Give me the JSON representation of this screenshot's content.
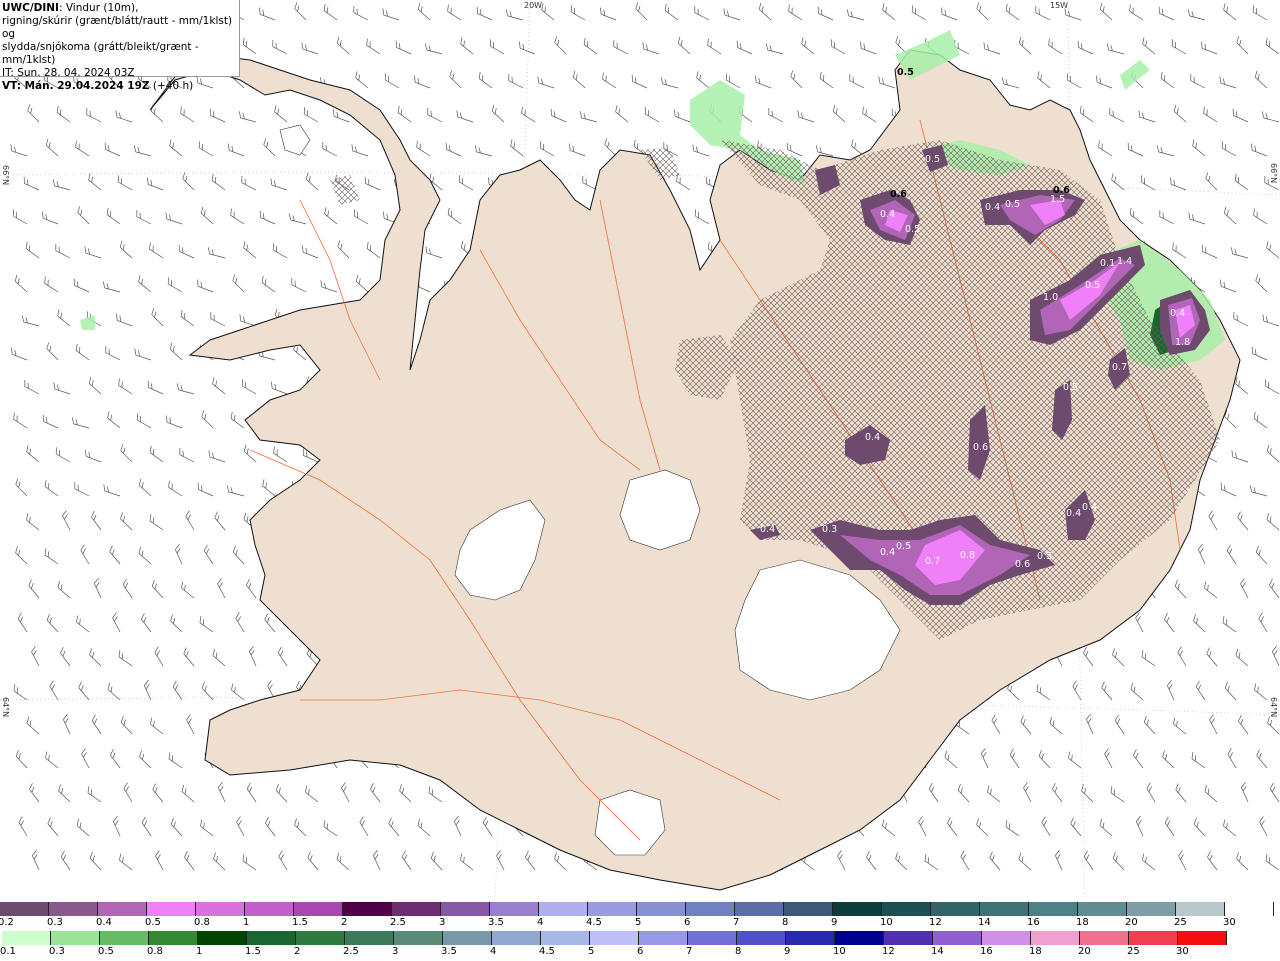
{
  "header": {
    "model": "UWC/DINI",
    "line1_rest": ": Vindur (10m),",
    "line2": "rigning/skúrir (grænt/blátt/rautt - mm/1klst) og",
    "line3": "slydda/snjókoma (grátt/bleikt/grænt - mm/1klst)",
    "it": "IT: Sun. 28. 04. 2024 03Z",
    "vt_bold": "VT: Mán. 29.04.2024 19Z",
    "vt_rest": " (+40 h)"
  },
  "grid_labels": {
    "lon20": "20W",
    "lon15": "15W",
    "lat66_left": "66°N",
    "lat66_right": "66°N",
    "lat64_left": "64°N",
    "lat64_right": "64°N"
  },
  "map_labels": [
    {
      "text": "0.5",
      "color": "#000000"
    },
    {
      "text": "0.5",
      "color": "#ffffff"
    },
    {
      "text": "0.6",
      "color": "#000000"
    },
    {
      "text": "0.6",
      "color": "#000000"
    },
    {
      "text": "0.4",
      "color": "#ffffff"
    },
    {
      "text": "0.5",
      "color": "#ffffff"
    },
    {
      "text": "1.5",
      "color": "#ffffff"
    },
    {
      "text": "0.4",
      "color": "#ffffff"
    },
    {
      "text": "0.5",
      "color": "#ffffff"
    },
    {
      "text": "0.1",
      "color": "#ffffff"
    },
    {
      "text": "1.4",
      "color": "#ffffff"
    },
    {
      "text": "0.5",
      "color": "#ffffff"
    },
    {
      "text": "1.0",
      "color": "#ffffff"
    },
    {
      "text": "0.4",
      "color": "#ffffff"
    },
    {
      "text": "1.8",
      "color": "#ffffff"
    },
    {
      "text": "0.7",
      "color": "#ffffff"
    },
    {
      "text": "0.5",
      "color": "#ffffff"
    },
    {
      "text": "0.4",
      "color": "#ffffff"
    },
    {
      "text": "0.6",
      "color": "#ffffff"
    },
    {
      "text": "0.4",
      "color": "#ffffff"
    },
    {
      "text": "0.4",
      "color": "#ffffff"
    },
    {
      "text": "0.4",
      "color": "#ffffff"
    },
    {
      "text": "0.3",
      "color": "#ffffff"
    },
    {
      "text": "0.4",
      "color": "#ffffff"
    },
    {
      "text": "0.5",
      "color": "#ffffff"
    },
    {
      "text": "0.7",
      "color": "#ffffff"
    },
    {
      "text": "0.8",
      "color": "#ffffff"
    },
    {
      "text": "0.6",
      "color": "#ffffff"
    },
    {
      "text": "0.5",
      "color": "#ffffff"
    }
  ],
  "legend_snow": [
    {
      "label": "0.2",
      "color": "#6e4a6e"
    },
    {
      "label": "0.3",
      "color": "#8a5a8f"
    },
    {
      "label": "0.4",
      "color": "#b065b7"
    },
    {
      "label": "0.5",
      "color": "#f080f8"
    },
    {
      "label": "0.8",
      "color": "#d872e0"
    },
    {
      "label": "1",
      "color": "#c060c8"
    },
    {
      "label": "1.5",
      "color": "#a848b0"
    },
    {
      "label": "2",
      "color": "#540048"
    },
    {
      "label": "2.5",
      "color": "#6e2d70"
    },
    {
      "label": "3",
      "color": "#8858a8"
    },
    {
      "label": "3.5",
      "color": "#9a80d0"
    },
    {
      "label": "4",
      "color": "#b0b0f0"
    },
    {
      "label": "4.5",
      "color": "#9a9ae0"
    },
    {
      "label": "5",
      "color": "#8890d0"
    },
    {
      "label": "6",
      "color": "#7080c0"
    },
    {
      "label": "7",
      "color": "#5c6ea8"
    },
    {
      "label": "8",
      "color": "#3c5a78"
    },
    {
      "label": "9",
      "color": "#0c3c3c"
    },
    {
      "label": "10",
      "color": "#1a5050"
    },
    {
      "label": "12",
      "color": "#306468"
    },
    {
      "label": "14",
      "color": "#3e7478"
    },
    {
      "label": "16",
      "color": "#4e8088"
    },
    {
      "label": "18",
      "color": "#628c94"
    },
    {
      "label": "20",
      "color": "#7e9ea6"
    },
    {
      "label": "25",
      "color": "#b8c8cc"
    },
    {
      "label": "30",
      "color": "#ffffff"
    }
  ],
  "legend_rain": [
    {
      "label": "0.1",
      "color": "#ccffcc"
    },
    {
      "label": "0.3",
      "color": "#99e699"
    },
    {
      "label": "0.5",
      "color": "#66bb66"
    },
    {
      "label": "0.8",
      "color": "#338833"
    },
    {
      "label": "1",
      "color": "#004400"
    },
    {
      "label": "1.5",
      "color": "#1a6630"
    },
    {
      "label": "2",
      "color": "#2f7a3f"
    },
    {
      "label": "2.5",
      "color": "#3c7a5a"
    },
    {
      "label": "3",
      "color": "#5a8a78"
    },
    {
      "label": "3.5",
      "color": "#7898a8"
    },
    {
      "label": "4",
      "color": "#90a8d0"
    },
    {
      "label": "4.5",
      "color": "#a8b8e8"
    },
    {
      "label": "5",
      "color": "#c0c0f8"
    },
    {
      "label": "6",
      "color": "#9898e8"
    },
    {
      "label": "7",
      "color": "#7070d8"
    },
    {
      "label": "8",
      "color": "#5050c8"
    },
    {
      "label": "9",
      "color": "#2828b0"
    },
    {
      "label": "10",
      "color": "#000090"
    },
    {
      "label": "12",
      "color": "#5030b0"
    },
    {
      "label": "14",
      "color": "#9060d0"
    },
    {
      "label": "16",
      "color": "#d090e8"
    },
    {
      "label": "18",
      "color": "#f0a0d0"
    },
    {
      "label": "20",
      "color": "#f07090"
    },
    {
      "label": "25",
      "color": "#f04050"
    },
    {
      "label": "30",
      "color": "#f01010"
    }
  ]
}
